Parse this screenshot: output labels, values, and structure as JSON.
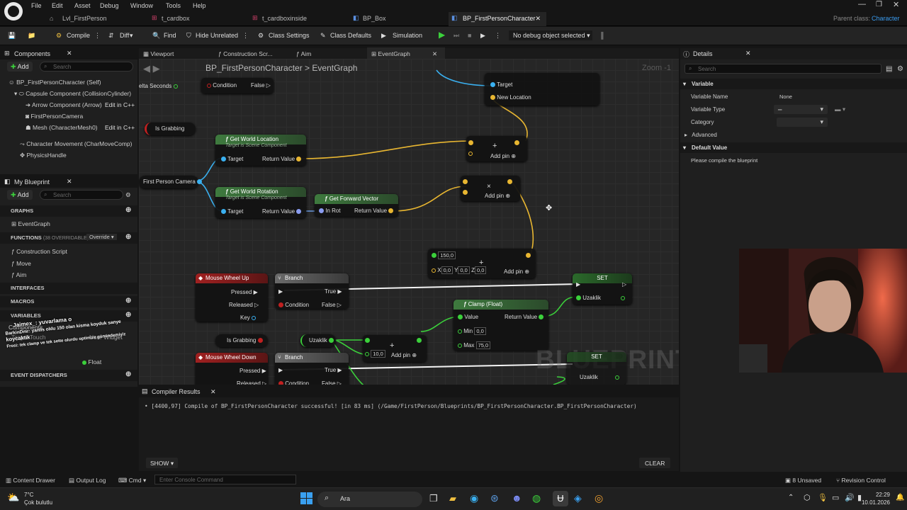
{
  "menu": [
    "File",
    "Edit",
    "Asset",
    "Debug",
    "Window",
    "Tools",
    "Help"
  ],
  "tabs": [
    {
      "label": "Lvl_FirstPerson"
    },
    {
      "label": "t_cardbox"
    },
    {
      "label": "t_cardboxinside"
    },
    {
      "label": "BP_Box"
    },
    {
      "label": "BP_FirstPersonCharacter"
    }
  ],
  "parent_class": {
    "label": "Parent class:",
    "value": "Character"
  },
  "toolbar": {
    "compile": "Compile",
    "diff": "Diff",
    "find": "Find",
    "hide_unrelated": "Hide Unrelated",
    "class_settings": "Class Settings",
    "class_defaults": "Class Defaults",
    "simulation": "Simulation",
    "debug_select": "No debug object selected"
  },
  "components": {
    "title": "Components",
    "add": "Add",
    "search": "Search",
    "items": [
      "BP_FirstPersonCharacter (Self)",
      "Capsule Component (CollisionCylinder)",
      "Arrow Component (Arrow)",
      "FirstPersonCamera",
      "Mesh (CharacterMesh0)",
      "Character Movement (CharMoveComp)",
      "PhysicsHandle"
    ],
    "edit_cpp": "Edit in C++"
  },
  "my_blueprint": {
    "title": "My Blueprint",
    "add": "Add",
    "search": "Search",
    "graphs": "GRAPHS",
    "event_graph": "EventGraph",
    "functions": "FUNCTIONS",
    "overridable": "(38 OVERRIDABLE)",
    "override": "Override",
    "function_items": [
      "Construction Script",
      "Move",
      "Aim"
    ],
    "interfaces": "INTERFACES",
    "macros": "MACROS",
    "variables": "VARIABLES",
    "variable_items": [
      "Components",
      "Target Touch",
      "User Widget",
      "Float"
    ],
    "event_dispatchers": "EVENT DISPATCHERS"
  },
  "chat_overlay": [
    "Jaimex_: yuvarlama o",
    "BarkinDmr: yanlis oldu 150 olan kisma koyduk sanye",
    "koycaktik",
    "Frosi: tek clamp ve tek sette olurdu optimize günündemiyiz"
  ],
  "graph_tabs": [
    "Viewport",
    "Construction Scr...",
    "Aim",
    "EventGraph"
  ],
  "breadcrumb": {
    "root": "BP_FirstPersonCharacter",
    "leaf": "EventGraph",
    "zoom": "Zoom -1"
  },
  "nodes": {
    "delta": "elta Seconds",
    "condition": "Condition",
    "false": "False",
    "is_grabbing": "Is Grabbing",
    "target": "Target",
    "new_location": "New Location",
    "get_world_location": "Get World Location",
    "scene_sub": "Target is Scene Component",
    "return_value": "Return Value",
    "add_pin": "Add pin",
    "fp_camera": "First Person Camera",
    "get_world_rotation": "Get World Rotation",
    "get_forward_vector": "Get Forward Vector",
    "in_rot": "In Rot",
    "v150": "150,0",
    "v00": "0,0",
    "mouse_wheel_up": "Mouse Wheel Up",
    "pressed": "Pressed",
    "released": "Released",
    "key": "Key",
    "branch": "Branch",
    "true": "True",
    "set": "SET",
    "uzaklik": "Uzaklik",
    "clamp": "Clamp (Float)",
    "value": "Value",
    "min": "Min",
    "max": "Max",
    "vmin": "0,0",
    "vmax": "75,0",
    "v10": "10,0",
    "mouse_wheel_down": "Mouse Wheel Down",
    "watermark": "BLUEPRINT"
  },
  "compiler": {
    "title": "Compiler Results",
    "message": "• [4400,97] Compile of BP_FirstPersonCharacter successful! [in 83 ms] (/Game/FirstPerson/Blueprints/BP_FirstPersonCharacter.BP_FirstPersonCharacter)",
    "show": "SHOW",
    "clear": "CLEAR"
  },
  "details": {
    "title": "Details",
    "search": "Search",
    "variable": "Variable",
    "variable_name_label": "Variable Name",
    "variable_name": "None",
    "variable_type_label": "Variable Type",
    "category_label": "Category",
    "advanced": "Advanced",
    "default_value": "Default Value",
    "compile_msg": "Please compile the blueprint"
  },
  "bottombar": {
    "content_drawer": "Content Drawer",
    "output_log": "Output Log",
    "cmd": "Cmd",
    "console": "Enter Console Command",
    "unsaved": "8 Unsaved",
    "revision": "Revision Control"
  },
  "taskbar": {
    "temp": "7°C",
    "weather": "Çok bulutlu",
    "search": "Ara",
    "time": "22:29",
    "date": "10.01.2026"
  }
}
